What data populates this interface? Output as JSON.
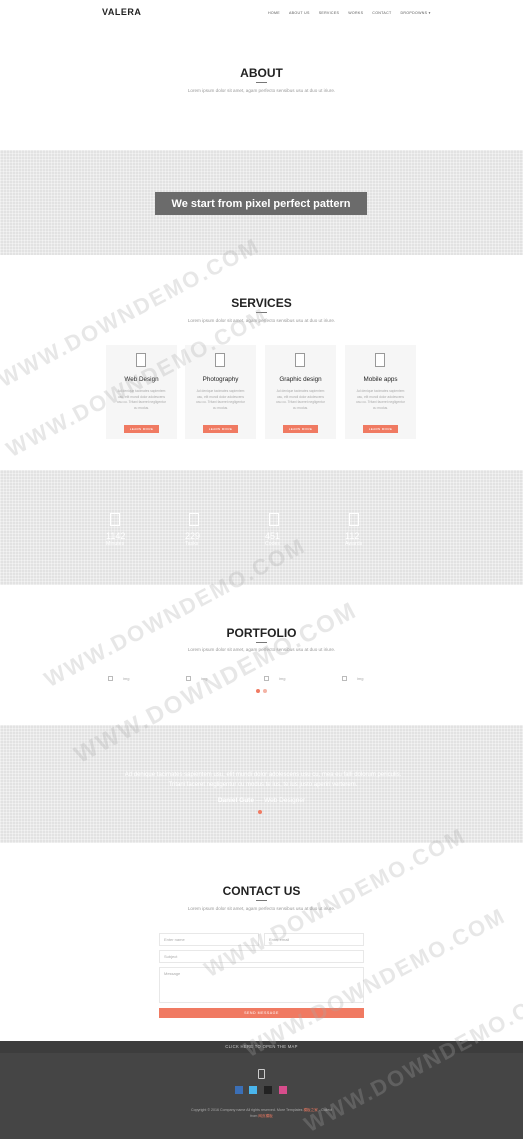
{
  "nav": {
    "brand": "VALERA",
    "items": [
      "HOME",
      "ABOUT US",
      "SERVICES",
      "WORKS",
      "CONTACT",
      "DROPDOWNS ▾"
    ]
  },
  "about": {
    "title": "ABOUT",
    "subtitle": "Lorem ipsum dolor sit amet, agam perfecto sensibus usu at duo ut iriure."
  },
  "hero": {
    "text": "We start from pixel perfect pattern"
  },
  "services": {
    "title": "SERVICES",
    "subtitle": "Lorem ipsum dolor sit amet, agam perfecto sensibus usu at duo ut iriure.",
    "cards": [
      {
        "title": "Web Design",
        "desc": "Ad denique tacimates sapientem usu, elit mundi dolor adolescens usu cu. Tritani faceret negligentur cu modus.",
        "button": "LEARN MORE"
      },
      {
        "title": "Photography",
        "desc": "Ad denique tacimates sapientem usu, elit mundi dolor adolescens usu cu. Tritani faceret negligentur cu modus.",
        "button": "LEARN MORE"
      },
      {
        "title": "Graphic design",
        "desc": "Ad denique tacimates sapientem usu, elit mundi dolor adolescens usu cu. Tritani faceret negligentur cu modus.",
        "button": "LEARN MORE"
      },
      {
        "title": "Mobile apps",
        "desc": "Ad denique tacimates sapientem usu, elit mundi dolor adolescens usu cu. Tritani faceret negligentur cu modus.",
        "button": "LEARN MORE"
      }
    ]
  },
  "stats": [
    {
      "number": "1142",
      "label": "Minutes"
    },
    {
      "number": "229",
      "label": "Tasks"
    },
    {
      "number": "451",
      "label": "Codes"
    },
    {
      "number": "112",
      "label": "Awards"
    }
  ],
  "portfolio": {
    "title": "PORTFOLIO",
    "subtitle": "Lorem ipsum dolor sit amet, agam perfecto sensibus usu at duo ut iriure.",
    "images": [
      "img",
      "img",
      "img",
      "img"
    ]
  },
  "testimonial": {
    "quote": "Ad denique tacimates sapientem usu, elit mundi dolor adolescens usu cu, mea eu falli dolorum periculis. Tritani faceret negligentur cu modus te ius, te ius justo aperiri verterem.",
    "author": "Daniel Gute",
    "role": "— Web Designer"
  },
  "contact": {
    "title": "CONTACT US",
    "subtitle": "Lorem ipsum dolor sit amet, agam perfecto sensibus usu at duo ut iriure.",
    "name_placeholder": "Enter name",
    "email_placeholder": "Enter email",
    "subject_placeholder": "Subject",
    "message_placeholder": "Message",
    "send_label": "SEND MESSAGE"
  },
  "footer": {
    "map_toggle": "CLICK HERE TO OPEN THE MAP",
    "copyright": "Copyright © 2016 Company name All rights reserved. More Templates",
    "copyright_link": "模板之家",
    "copyright_tail": "- Collect from",
    "copyright_tail_link": "网页模板"
  },
  "watermark": "WWW.DOWNDEMO.COM",
  "colors": {
    "accent": "#f07a62",
    "band": "#e2e2e2",
    "footer": "#454545",
    "social": [
      "#3b6fb6",
      "#4ab5ec",
      "#222222",
      "#d74d8c"
    ]
  }
}
